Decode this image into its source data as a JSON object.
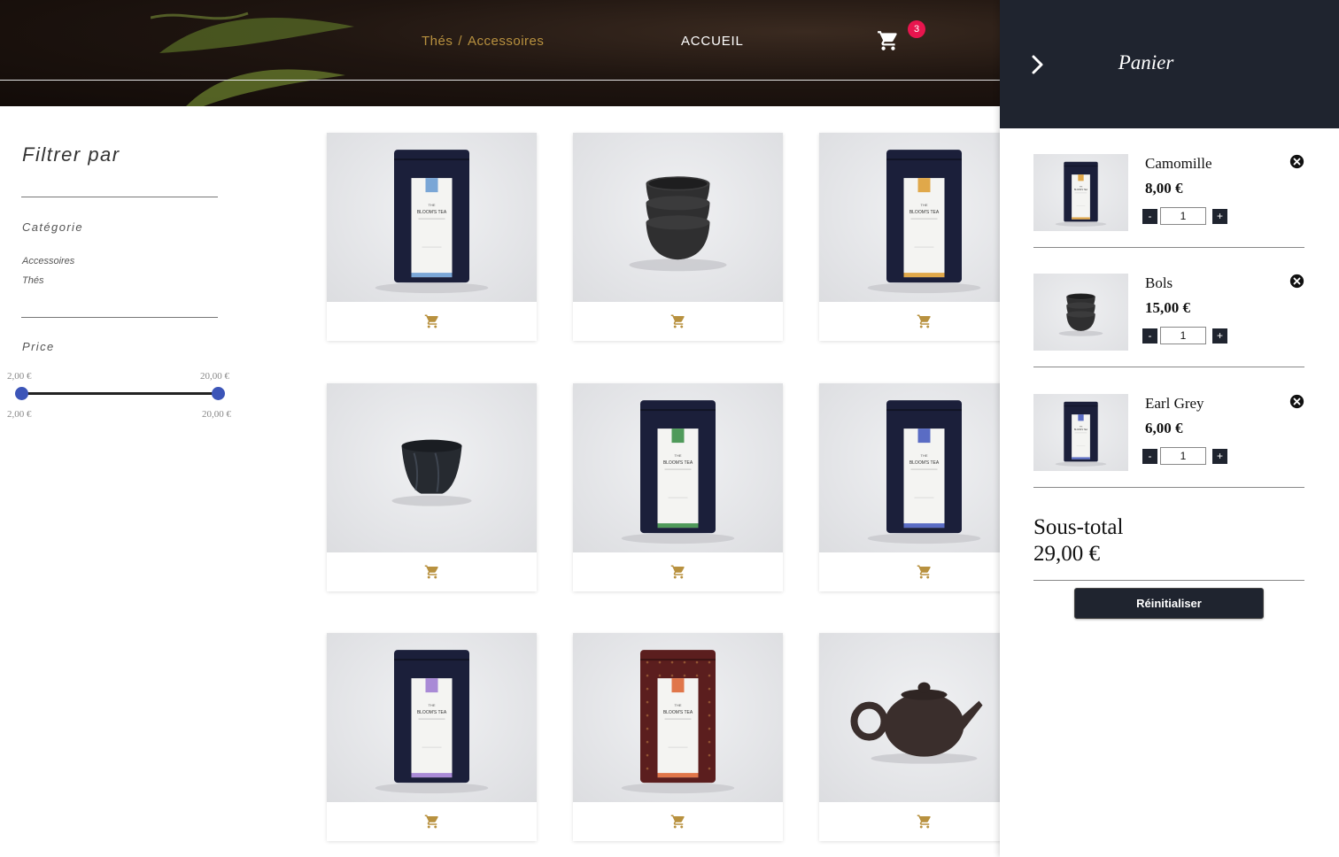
{
  "header": {
    "breadcrumb": {
      "item1": "Thés",
      "separator": "/",
      "item2": "Accessoires"
    },
    "nav_home": "ACCUEIL",
    "cart_count": "3",
    "cart_icon": "shopping-cart-icon",
    "accent_color": "#b8913f",
    "badge_color": "#e8154e"
  },
  "filters": {
    "title": "Filtrer par",
    "category_label": "Catégorie",
    "categories": [
      "Accessoires",
      "Thés"
    ],
    "price_label": "Price",
    "price_min_top": "2,00 €",
    "price_max_top": "20,00 €",
    "price_min_bottom": "2,00 €",
    "price_max_bottom": "20,00 €",
    "slider_color": "#3c55b8"
  },
  "products": [
    {
      "kind": "tea",
      "label_color": "#7aa6d6"
    },
    {
      "kind": "bowls"
    },
    {
      "kind": "tea",
      "label_color": "#e0a84a"
    },
    {
      "kind": "bowl"
    },
    {
      "kind": "tea",
      "label_color": "#4f9a5a"
    },
    {
      "kind": "tea",
      "label_color": "#5a6cc4"
    },
    {
      "kind": "tea",
      "label_color": "#a98ad6"
    },
    {
      "kind": "tea-red",
      "label_color": "#e0764a"
    },
    {
      "kind": "teapot"
    }
  ],
  "package_text": {
    "line1": "THE",
    "line2": "BLOOM'S TEA"
  },
  "cart_panel": {
    "title": "Panier",
    "items": [
      {
        "name": "Camomille",
        "price": "8,00 €",
        "qty": "1",
        "thumb": "tea",
        "label_color": "#e0a84a"
      },
      {
        "name": "Bols",
        "price": "15,00 €",
        "qty": "1",
        "thumb": "bowls"
      },
      {
        "name": "Earl Grey",
        "price": "6,00 €",
        "qty": "1",
        "thumb": "tea",
        "label_color": "#5a6cc4"
      }
    ],
    "minus_label": "-",
    "plus_label": "+",
    "subtotal_label": "Sous-total",
    "subtotal_value": "29,00 €",
    "reset_label": "Réinitialiser",
    "panel_color": "#1f242f"
  }
}
